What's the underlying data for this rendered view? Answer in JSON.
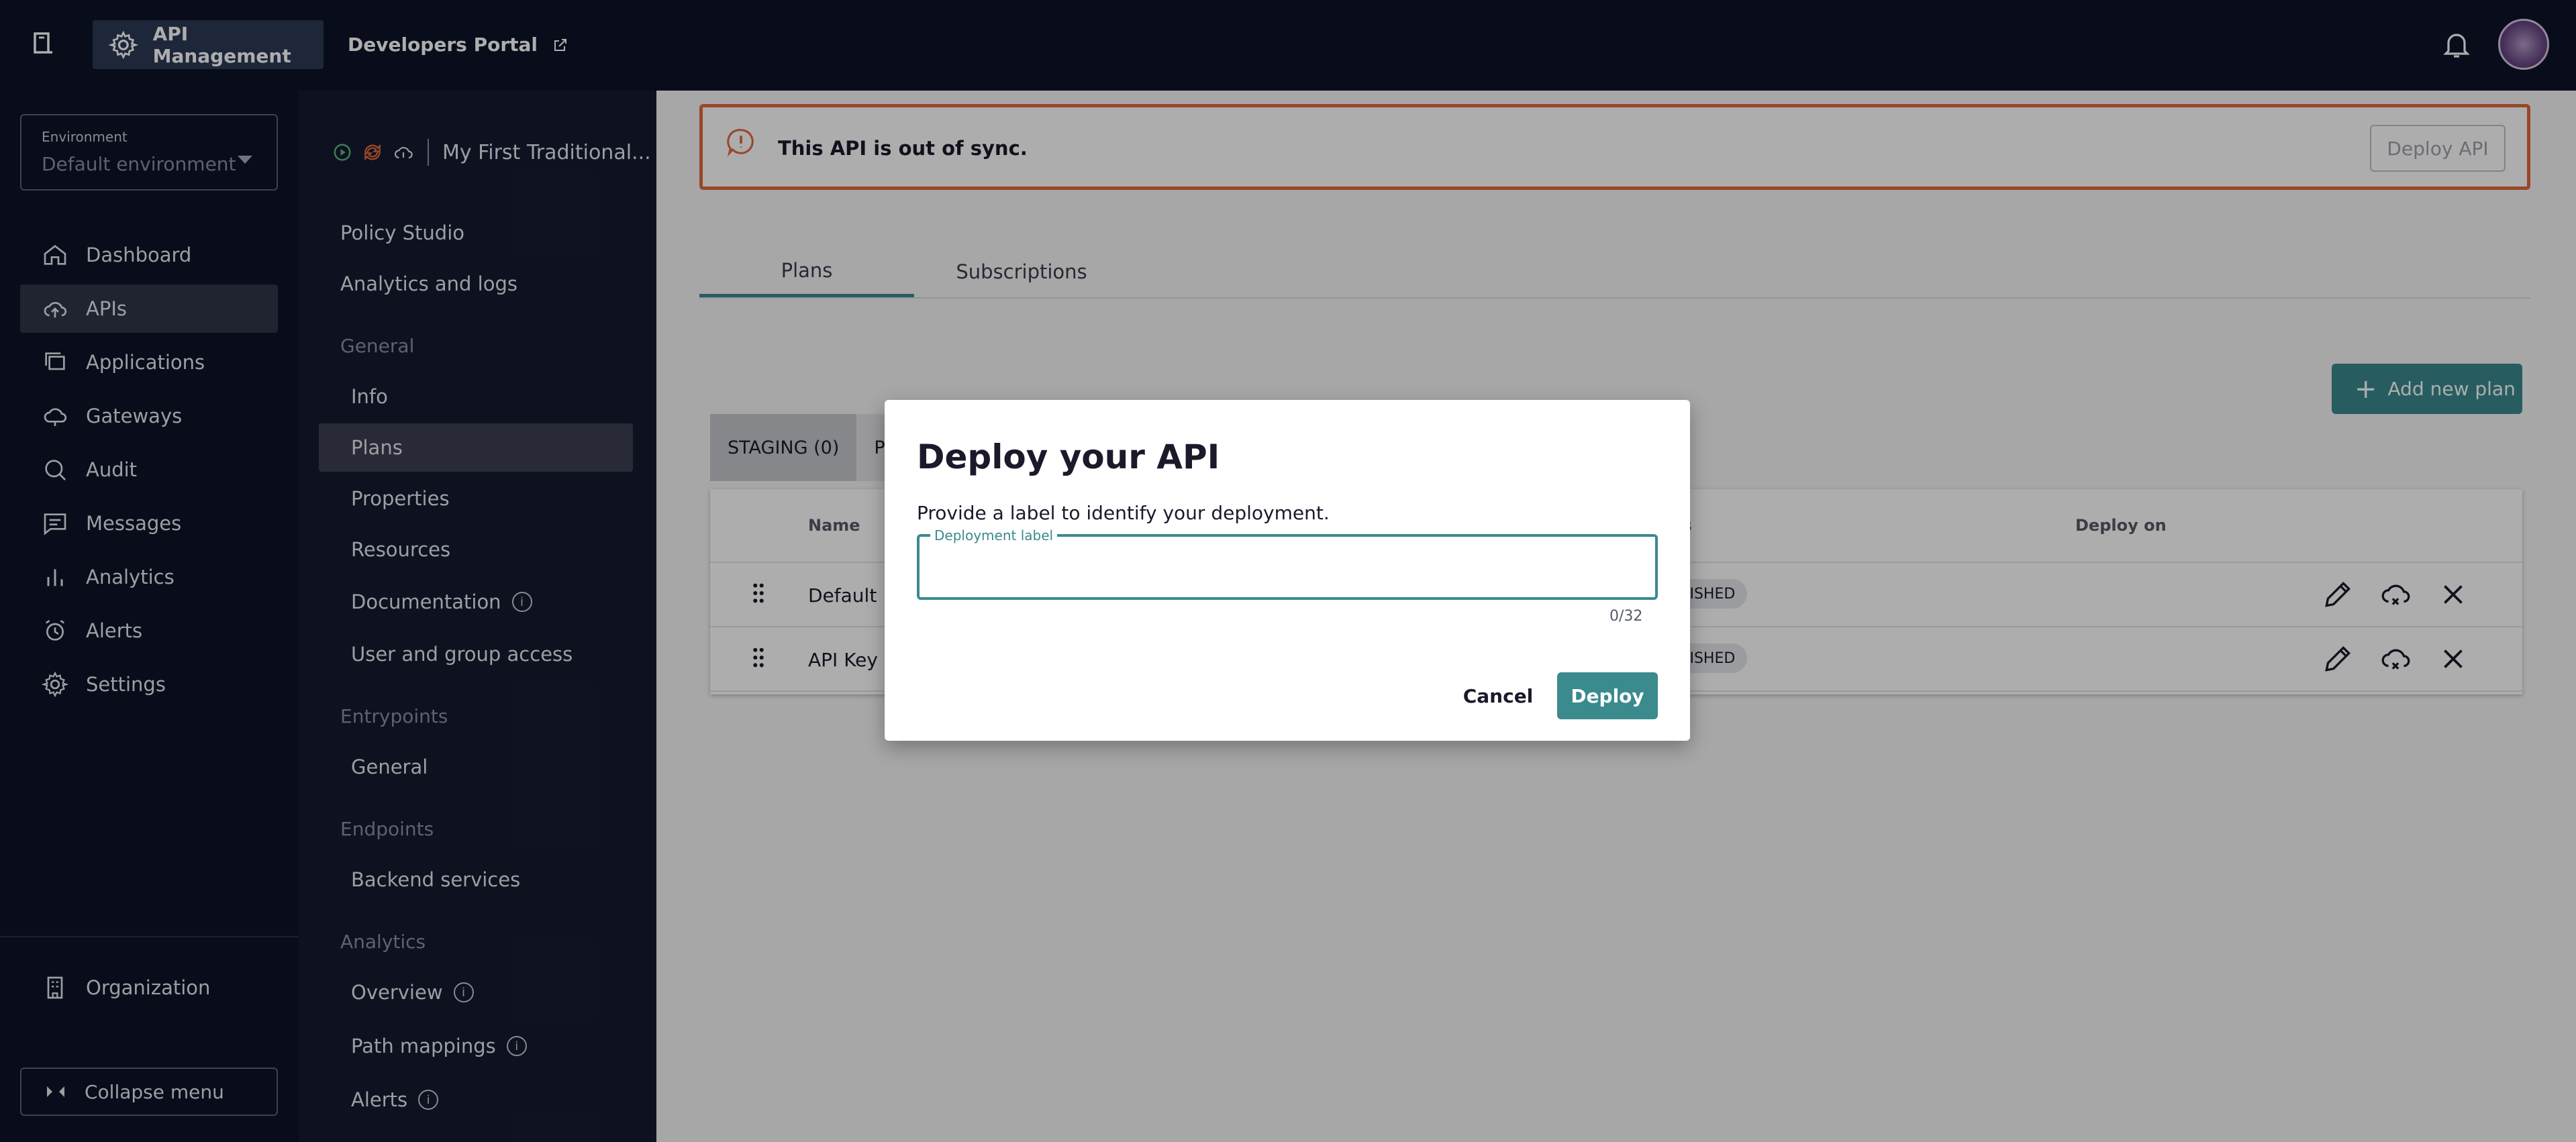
{
  "topbar": {
    "active_tab": "API Management",
    "portal_tab": "Developers Portal"
  },
  "environment": {
    "label": "Environment",
    "value": "Default environment"
  },
  "nav": {
    "items": [
      "Dashboard",
      "APIs",
      "Applications",
      "Gateways",
      "Audit",
      "Messages",
      "Analytics",
      "Alerts",
      "Settings"
    ],
    "active": "APIs",
    "organization": "Organization",
    "collapse": "Collapse menu"
  },
  "api": {
    "name": "My First Traditional..."
  },
  "subnav": {
    "policy_studio": "Policy Studio",
    "analytics_logs": "Analytics and logs",
    "general_section": "General",
    "info": "Info",
    "plans": "Plans",
    "properties": "Properties",
    "resources": "Resources",
    "documentation": "Documentation",
    "user_group_access": "User and group access",
    "entrypoints_section": "Entrypoints",
    "entrypoints_general": "General",
    "endpoints_section": "Endpoints",
    "backend_services": "Backend services",
    "analytics_section": "Analytics",
    "overview": "Overview",
    "path_mappings": "Path mappings",
    "alerts": "Alerts"
  },
  "banner": {
    "message": "This API is out of sync.",
    "deploy_button": "Deploy API"
  },
  "tabs": [
    "Plans",
    "Subscriptions"
  ],
  "add_plan_button": "Add new plan",
  "status_tabs": [
    "STAGING (0)",
    "PU"
  ],
  "table": {
    "headers": {
      "name": "Name",
      "status": "tus",
      "deploy_on": "Deploy on"
    },
    "rows": [
      {
        "name": "Default K",
        "status": "UBLISHED"
      },
      {
        "name": "API Key I",
        "status": "UBLISHED"
      }
    ]
  },
  "dialog": {
    "title": "Deploy your API",
    "description": "Provide a label to identify your deployment.",
    "field_label": "Deployment label",
    "field_value": "",
    "counter": "0/32",
    "cancel": "Cancel",
    "deploy": "Deploy"
  },
  "colors": {
    "nav_bg": "#0e1227",
    "accent": "#3a8a8e",
    "warning": "#e06a3b"
  }
}
